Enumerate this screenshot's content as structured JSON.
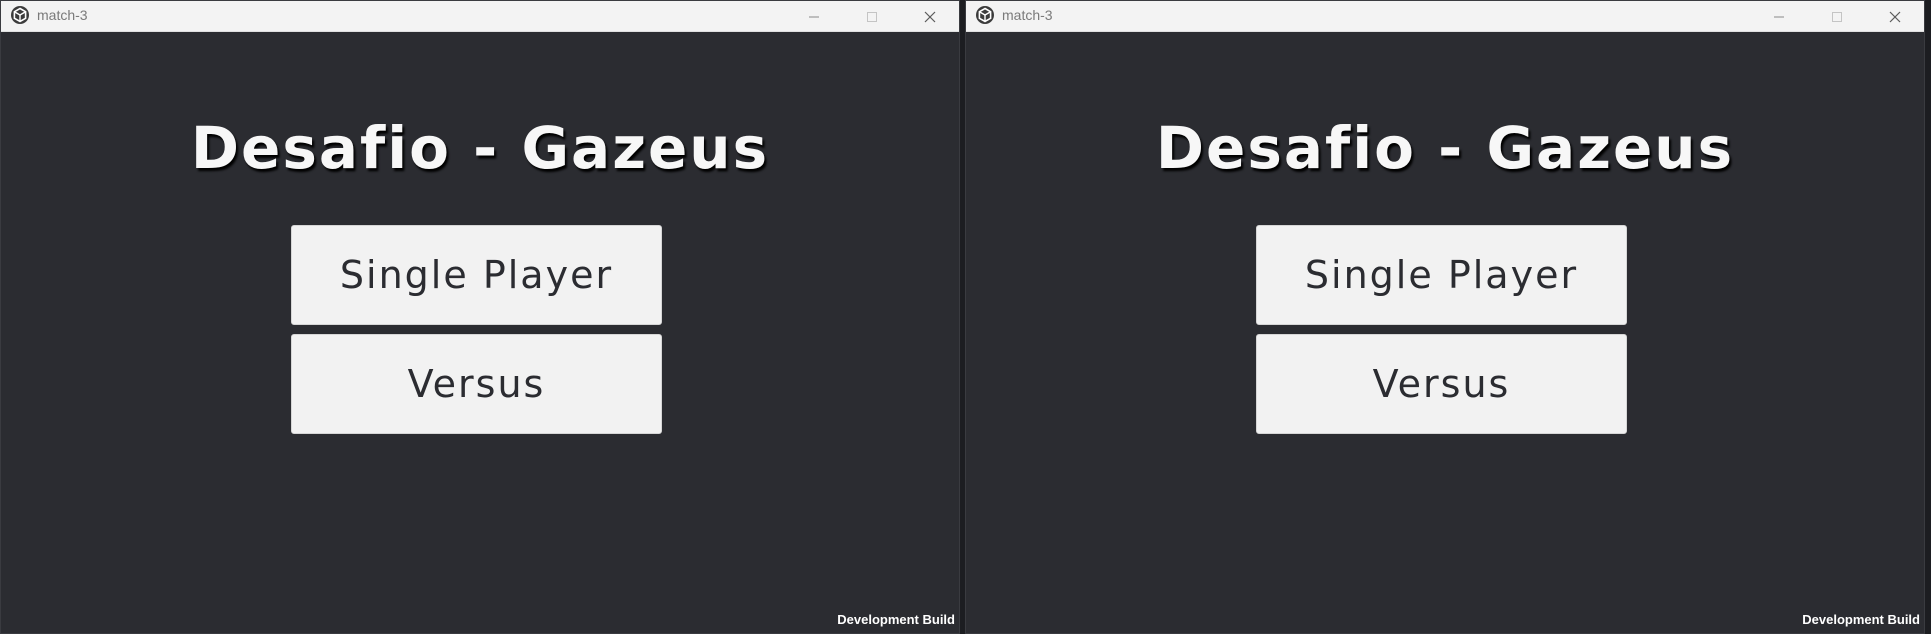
{
  "windows": [
    {
      "title": "match-3",
      "game_title": "Desafio - Gazeus",
      "buttons": {
        "single_player": "Single Player",
        "versus": "Versus"
      },
      "watermark": "Development Build"
    },
    {
      "title": "match-3",
      "game_title": "Desafio - Gazeus",
      "buttons": {
        "single_player": "Single Player",
        "versus": "Versus"
      },
      "watermark": "Development Build"
    }
  ],
  "icons": {
    "app": "unity-icon",
    "minimize": "minimize-icon",
    "maximize": "maximize-icon",
    "close": "close-icon"
  },
  "colors": {
    "titlebar_bg": "#f3f3f3",
    "game_bg": "#2b2c31",
    "button_bg": "#f2f2f2",
    "button_text": "#2b2c31",
    "title_text": "#f7f7f7"
  }
}
